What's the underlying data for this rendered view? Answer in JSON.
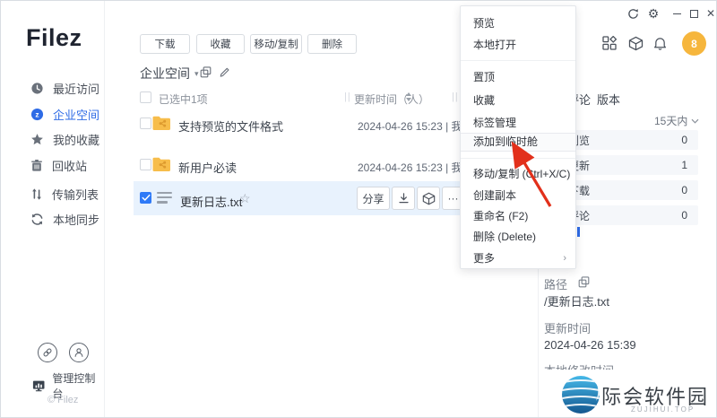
{
  "sidebar": {
    "logo": "Filez",
    "items": [
      {
        "label": "最近访问",
        "active": false
      },
      {
        "label": "企业空间",
        "active": true
      },
      {
        "label": "我的收藏",
        "active": false
      },
      {
        "label": "回收站",
        "active": false
      },
      {
        "label": "传输列表",
        "active": false
      },
      {
        "label": "本地同步",
        "active": false
      }
    ],
    "footer": {
      "admin_console": "管理控制台",
      "copyright": "© Filez"
    }
  },
  "topbar": {
    "avatar_label": "8"
  },
  "toolbar": {
    "download": "下载",
    "favorite": "收藏",
    "move_copy": "移动/复制",
    "delete": "删除"
  },
  "breadcrumb": {
    "location": "企业空间"
  },
  "file_list": {
    "selection_summary": "已选中1项",
    "updated_column": "更新时间（人）",
    "column_divider": "||",
    "rows": [
      {
        "name": "支持预览的文件格式",
        "updated": "2024-04-26 15:23 | 我"
      },
      {
        "name": "新用户必读",
        "updated": "2024-04-26 15:23 | 我"
      },
      {
        "name": "更新日志.txt",
        "share_label": "分享",
        "more_label": "···"
      }
    ]
  },
  "context_menu": {
    "preview": "预览",
    "open_local": "本地打开",
    "pin": "置顶",
    "favorite": "收藏",
    "tag_manage": "标签管理",
    "add_temp": "添加到临时舱",
    "move_copy": "移动/复制 (Ctrl+X/C)",
    "duplicate": "创建副本",
    "rename": "重命名 (F2)",
    "delete": "删除 (Delete)",
    "more": "更多",
    "more_arrow": "›"
  },
  "details_panel": {
    "tabs": {
      "comments": "评论",
      "versions": "版本"
    },
    "filter": "15天内",
    "stats": [
      {
        "label": "浏览",
        "value": "0"
      },
      {
        "label": "更新",
        "value": "1"
      },
      {
        "label": "下载",
        "value": "0"
      },
      {
        "label": "评论",
        "value": "0"
      }
    ],
    "path_label": "路径",
    "path_value": "/更新日志.txt",
    "updated_label": "更新时间",
    "updated_value": "2024-04-26 15:39",
    "modified_label": "本地修改时间"
  },
  "watermark": {
    "title": "际会软件园",
    "subtitle": "ZUJIHUI.TOP"
  },
  "colors": {
    "accent_blue": "#2e6be6",
    "checkbox_blue": "#2f7af7",
    "selected_row": "#e8f2fd",
    "folder_orange": "#f7bd4b",
    "avatar_orange": "#f6b63d",
    "arrow_red": "#e2301b"
  }
}
